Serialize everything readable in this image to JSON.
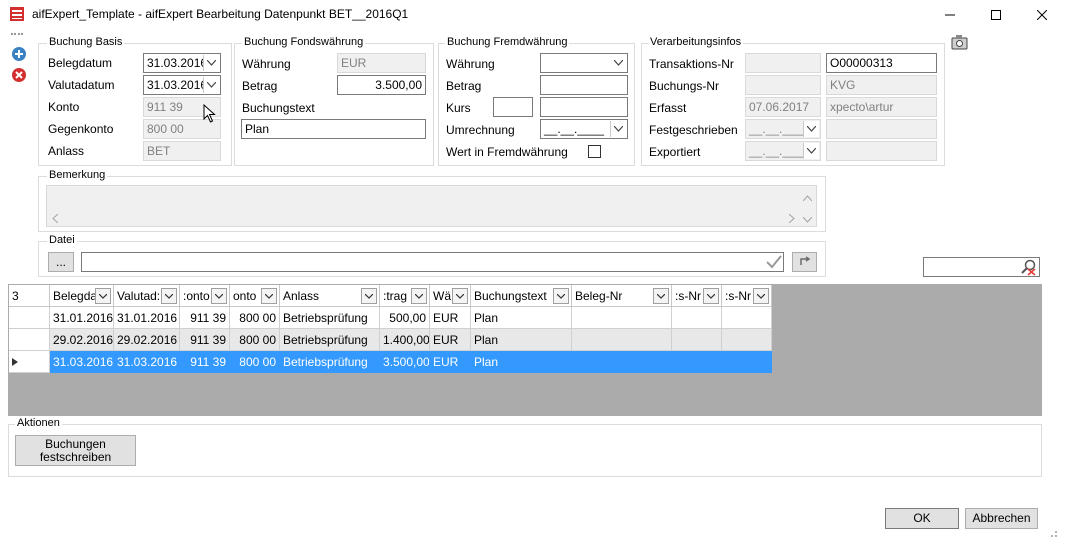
{
  "window": {
    "title": "aifExpert_Template - aifExpert Bearbeitung Datenpunkt BET__2016Q1"
  },
  "basis": {
    "legend": "Buchung Basis",
    "belegdatum_label": "Belegdatum",
    "belegdatum": "31.03.2016",
    "valutadatum_label": "Valutadatum",
    "valutadatum": "31.03.2016",
    "konto_label": "Konto",
    "konto": "911 39",
    "gegenkonto_label": "Gegenkonto",
    "gegenkonto": "800 00",
    "anlass_label": "Anlass",
    "anlass": "BET"
  },
  "fonds": {
    "legend": "Buchung Fondswährung",
    "waehrung_label": "Währung",
    "waehrung": "EUR",
    "betrag_label": "Betrag",
    "betrag": "3.500,00",
    "buchungstext_label": "Buchungstext",
    "buchungstext": "Plan"
  },
  "fremd": {
    "legend": "Buchung Fremdwährung",
    "waehrung_label": "Währung",
    "waehrung": "",
    "betrag_label": "Betrag",
    "betrag": "",
    "kurs_label": "Kurs",
    "kurs_a": "",
    "kurs_b": "",
    "umrechnung_label": "Umrechnung",
    "umrechnung": "__.__.____",
    "wert_label": "Wert in Fremdwährung"
  },
  "info": {
    "legend": "Verarbeitungsinfos",
    "transaktion_label": "Transaktions-Nr",
    "transaktion_a": "",
    "transaktion_b": "O00000313",
    "buchungsnr_label": "Buchungs-Nr",
    "buchungsnr_a": "",
    "buchungsnr_b": "KVG",
    "erfasst_label": "Erfasst",
    "erfasst_a": "07.06.2017",
    "erfasst_b": "xpecto\\artur",
    "festgeschrieben_label": "Festgeschrieben",
    "festgeschrieben_a": "__.__.____",
    "festgeschrieben_b": "",
    "exportiert_label": "Exportiert",
    "exportiert_a": "__.__.____",
    "exportiert_b": ""
  },
  "bemerkung": {
    "legend": "Bemerkung"
  },
  "datei": {
    "legend": "Datei",
    "browse_label": "...",
    "path": ""
  },
  "grid": {
    "row_count": "3",
    "headers": [
      "Belegda",
      "Valutad:",
      ":onto",
      "onto",
      "Anlass",
      ":trag",
      "Wä",
      "Buchungstext",
      "Beleg-Nr",
      ":s-Nr",
      ":s-Nr"
    ],
    "rows": [
      [
        "31.01.2016",
        "31.01.2016",
        "911 39",
        "800 00",
        "Betriebsprüfung",
        "500,00",
        "EUR",
        "Plan",
        "",
        "",
        ""
      ],
      [
        "29.02.2016",
        "29.02.2016",
        "911 39",
        "800 00",
        "Betriebsprüfung",
        "1.400,00",
        "EUR",
        "Plan",
        "",
        "",
        ""
      ],
      [
        "31.03.2016",
        "31.03.2016",
        "911 39",
        "800 00",
        "Betriebsprüfung",
        "3.500,00",
        "EUR",
        "Plan",
        "",
        "",
        ""
      ]
    ]
  },
  "aktionen": {
    "legend": "Aktionen",
    "festschreiben_line1": "Buchungen",
    "festschreiben_line2": "festschreiben"
  },
  "footer": {
    "ok": "OK",
    "cancel": "Abbrechen"
  },
  "colors": {
    "selection": "#3399ff",
    "grid_background": "#ababab",
    "alt_row": "#e8e8e8"
  }
}
